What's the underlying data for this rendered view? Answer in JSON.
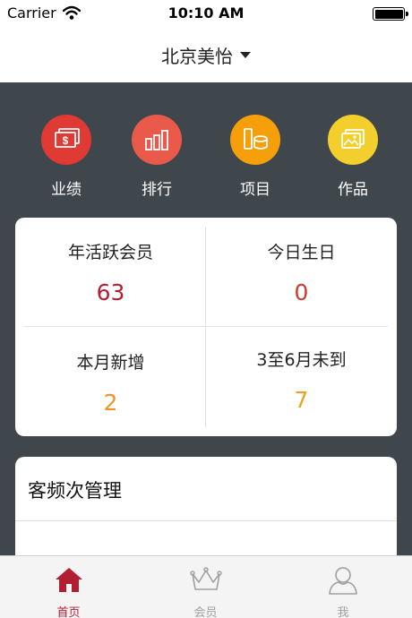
{
  "status_bar": {
    "carrier": "Carrier",
    "time": "10:10 AM"
  },
  "nav": {
    "title": "北京美怡"
  },
  "shortcuts": [
    {
      "label": "业绩",
      "icon": "money-icon",
      "color": "#e03a34"
    },
    {
      "label": "排行",
      "icon": "bar-chart-icon",
      "color": "#ea5a4a"
    },
    {
      "label": "项目",
      "icon": "cosmetics-icon",
      "color": "#f5a00a"
    },
    {
      "label": "作品",
      "icon": "gallery-icon",
      "color": "#f2cf2c"
    }
  ],
  "stats": [
    {
      "label": "年活跃会员",
      "value": "63",
      "color": "#b21f33"
    },
    {
      "label": "今日生日",
      "value": "0",
      "color": "#d23a2f"
    },
    {
      "label": "本月新增",
      "value": "2",
      "color": "#f0922c"
    },
    {
      "label": "3至6月未到",
      "value": "7",
      "color": "#f0a21e"
    }
  ],
  "manage": {
    "title": "客频次管理"
  },
  "tabs": [
    {
      "label": "首页",
      "icon": "home-icon",
      "active": true
    },
    {
      "label": "会员",
      "icon": "crown-icon",
      "active": false
    },
    {
      "label": "我",
      "icon": "user-icon",
      "active": false
    }
  ],
  "colors": {
    "active_tab": "#b21f33",
    "inactive_tab": "#a0a0a0",
    "background": "#3f474d"
  }
}
